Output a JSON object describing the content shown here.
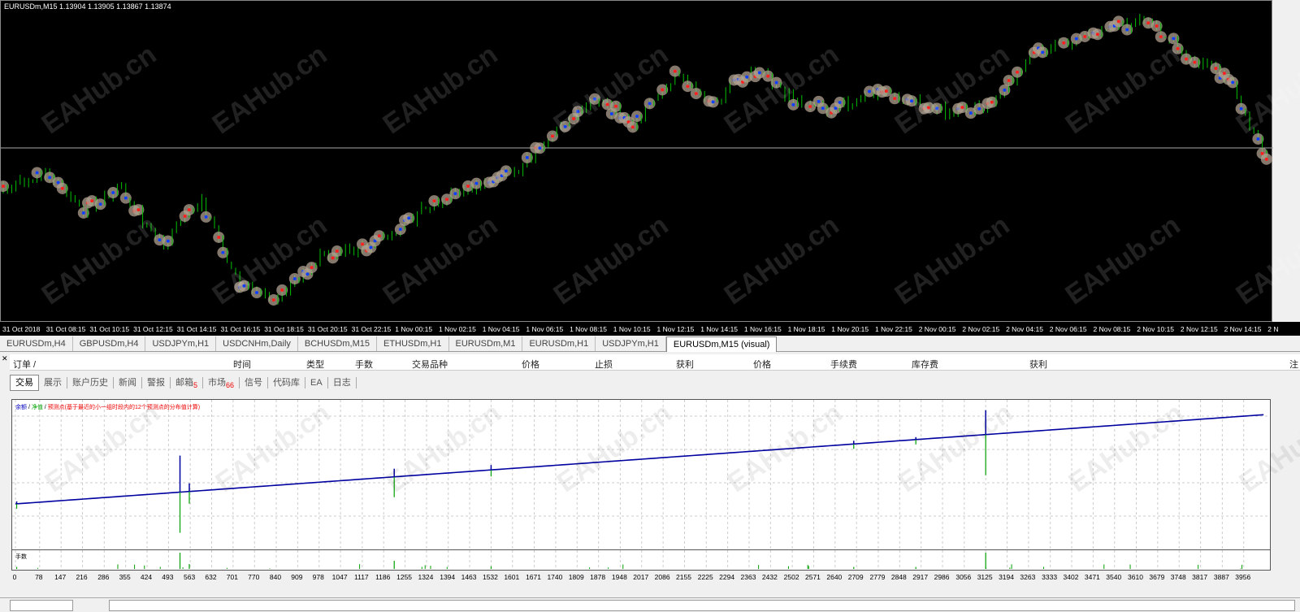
{
  "chart": {
    "title": "EURUSDm,M15  1.13904 1.13905 1.13867 1.13874",
    "time_labels": [
      "31 Oct 2018",
      "31 Oct 08:15",
      "31 Oct 10:15",
      "31 Oct 12:15",
      "31 Oct 14:15",
      "31 Oct 16:15",
      "31 Oct 18:15",
      "31 Oct 20:15",
      "31 Oct 22:15",
      "1 Nov 00:15",
      "1 Nov 02:15",
      "1 Nov 04:15",
      "1 Nov 06:15",
      "1 Nov 08:15",
      "1 Nov 10:15",
      "1 Nov 12:15",
      "1 Nov 14:15",
      "1 Nov 16:15",
      "1 Nov 18:15",
      "1 Nov 20:15",
      "1 Nov 22:15",
      "2 Nov 00:15",
      "2 Nov 02:15",
      "2 Nov 04:15",
      "2 Nov 06:15",
      "2 Nov 08:15",
      "2 Nov 10:15",
      "2 Nov 12:15",
      "2 Nov 14:15",
      "2 N"
    ],
    "price_path_relative": [
      0.38,
      0.45,
      0.32,
      0.38,
      0.2,
      0.35,
      0.05,
      0.02,
      0.15,
      0.18,
      0.25,
      0.35,
      0.4,
      0.45,
      0.6,
      0.7,
      0.62,
      0.78,
      0.7,
      0.8,
      0.7,
      0.66,
      0.72,
      0.7,
      0.65,
      0.68,
      0.85,
      0.9,
      0.95,
      0.97,
      0.85,
      0.78,
      0.5
    ],
    "watermark": "EAHub.cn",
    "colors": {
      "bull": "#00c000",
      "bear": "#00c000",
      "buy": "#1040ff",
      "sell": "#ff2020",
      "marker": "#b0a090"
    }
  },
  "tabs": [
    "EURUSDm,H4",
    "GBPUSDm,H4",
    "USDJPYm,H1",
    "USDCNHm,Daily",
    "BCHUSDm,M15",
    "ETHUSDm,H1",
    "EURUSDm,M1",
    "EURUSDm,H1",
    "USDJPYm,H1",
    "EURUSDm,M15 (visual)"
  ],
  "orders_header": [
    "订单  /",
    "时间",
    "类型",
    "手数",
    "交易品种",
    "价格",
    "止损",
    "获利",
    "价格",
    "手续费",
    "库存费",
    "获利",
    "注"
  ],
  "terminal_tabs": [
    {
      "label": "交易"
    },
    {
      "label": "展示"
    },
    {
      "label": "账户历史"
    },
    {
      "label": "新闻"
    },
    {
      "label": "警报"
    },
    {
      "label": "邮箱",
      "badge": "5"
    },
    {
      "label": "市场",
      "badge": "66"
    },
    {
      "label": "信号"
    },
    {
      "label": "代码库"
    },
    {
      "label": "EA"
    },
    {
      "label": "日志"
    }
  ],
  "equity": {
    "legend_balance": "余额",
    "legend_equity": "净值",
    "legend_forecast": "预测点(基于最近的小一组时段内的12个预测点的分布值计算)",
    "lots_label": "手数",
    "x_labels": [
      "0",
      "78",
      "147",
      "216",
      "286",
      "355",
      "424",
      "493",
      "563",
      "632",
      "701",
      "770",
      "840",
      "909",
      "978",
      "1047",
      "1117",
      "1186",
      "1255",
      "1324",
      "1394",
      "1463",
      "1532",
      "1601",
      "1671",
      "1740",
      "1809",
      "1878",
      "1948",
      "2017",
      "2086",
      "2155",
      "2225",
      "2294",
      "2363",
      "2432",
      "2502",
      "2571",
      "2640",
      "2709",
      "2779",
      "2848",
      "2917",
      "2986",
      "3056",
      "3125",
      "3194",
      "3263",
      "3333",
      "3402",
      "3471",
      "3540",
      "3610",
      "3679",
      "3748",
      "3817",
      "3887",
      "3956"
    ],
    "x_max": 4030,
    "balance_colors": {
      "balance": "#0000a0",
      "equity": "#00a000",
      "forecast": "#ff0000"
    }
  }
}
